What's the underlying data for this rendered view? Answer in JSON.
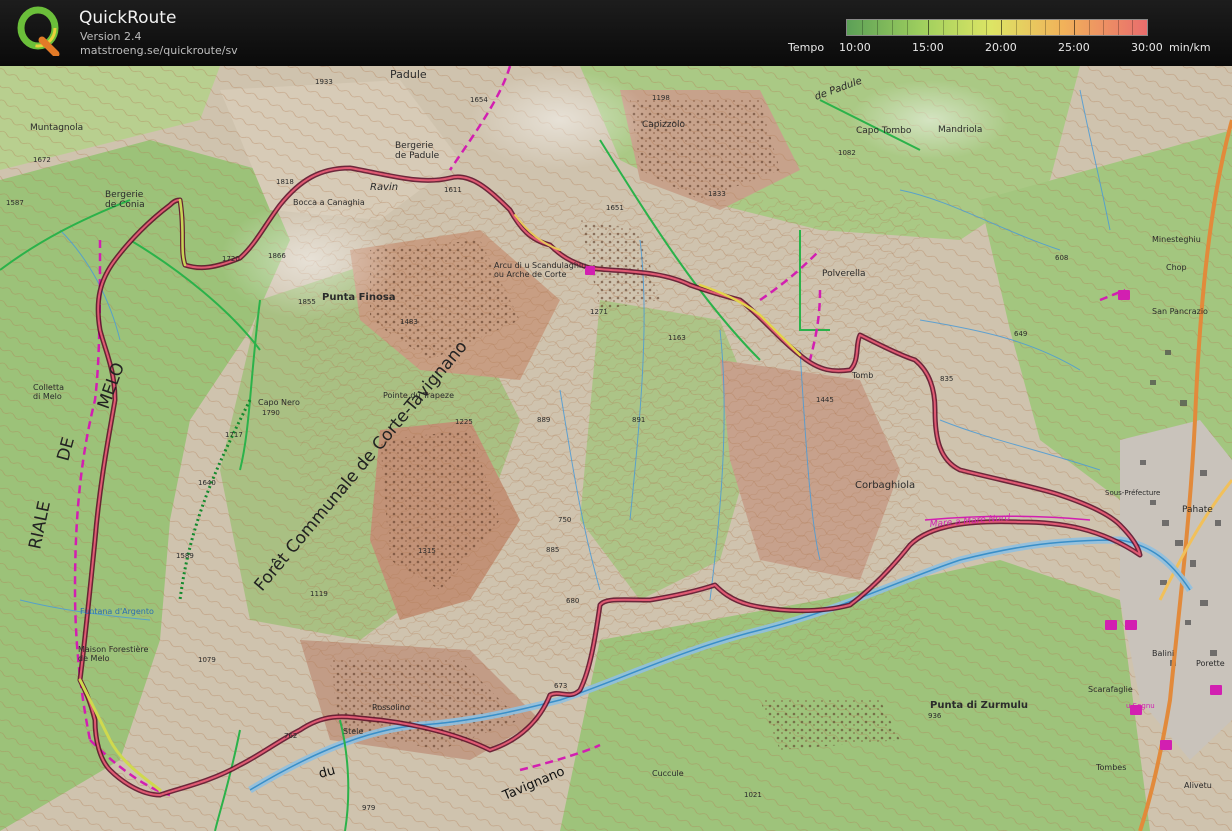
{
  "app": {
    "title": "QuickRoute",
    "version": "Version 2.4",
    "url": "matstroeng.se/quickroute/sv"
  },
  "legend": {
    "label": "Tempo",
    "unit": "min/km",
    "ticks": [
      "10:00",
      "15:00",
      "20:00",
      "25:00",
      "30:00"
    ],
    "colors": [
      "#5ca057",
      "#9fcf5e",
      "#dde565",
      "#f1b25a",
      "#e96d6d"
    ]
  },
  "map": {
    "route_color": "#8a1540",
    "trail_color": "#d21fb1",
    "labels": {
      "padule": "Padule",
      "bergerie_padule": "Bergerie\nde Padule",
      "muntagnola": "Muntagnola",
      "bergerie_conia": "Bergerie\nde Conia",
      "bocca_canaghia": "Bocca a Canaghia",
      "ravin": "Ravin",
      "ravin_padule": "de Padule",
      "capo_tombo": "Capo Tombo",
      "mandriola": "Mandriola",
      "capizzolo": "Capizzolo",
      "arcu": "Arcu di u Scandulaghiu\nou Arche de Corte",
      "polverella": "Polverella",
      "punta_finosa": "Punta Finosa",
      "minesteghiu": "Minesteghiu",
      "san_pancrazio": "San Pancrazio",
      "foret": "Forêt  Communale  de  Corte-Tavignano",
      "melo": "MELO",
      "de": "DE",
      "riale": "RIALE",
      "collettu": "Colletta\ndi Melo",
      "capo_nero": "Capo Nero",
      "pointe_trapeze": "Pointe du Trapeze",
      "corbaghiola": "Corbaghiola",
      "fontana": "Funtana d'Argento",
      "maison_forestiere": "Maison Forestière\nde Melo",
      "rossolino": "Rossolino",
      "stele": "Stele",
      "tavignano": "Tavignano",
      "du": "du",
      "cuccule": "Cuccule",
      "punta_zurmulu": "Punta di Zurmulu",
      "scarafaglie": "Scarafaglie",
      "balini": "Balini",
      "porette": "Porette",
      "alivetu": "Alivetu",
      "tombes": "Tombes",
      "sous_prefecture": "Sous-Préfecture",
      "pahate": "Pahate",
      "chop": "Chop",
      "tomb": "Tomb",
      "u_sognu": "u Sognu",
      "mare_a_mare": "Mare  a  Mare  Nord"
    },
    "elevations": [
      "1933",
      "1654",
      "1672",
      "1818",
      "1611",
      "1651",
      "1333",
      "1082",
      "1720",
      "1866",
      "1855",
      "1483",
      "1271",
      "1163",
      "835",
      "1790",
      "1717",
      "1640",
      "1589",
      "1079",
      "1225",
      "891",
      "889",
      "750",
      "885",
      "680",
      "673",
      "762",
      "979",
      "1021",
      "936",
      "608",
      "649",
      "1445",
      "1315",
      "1119",
      "1587",
      "1198"
    ]
  }
}
